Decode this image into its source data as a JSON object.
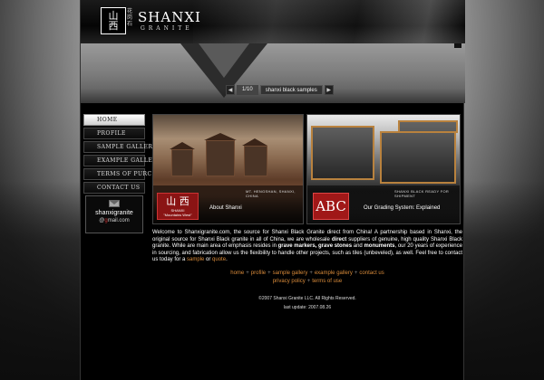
{
  "header": {
    "logo_chars": "山\n西",
    "logo_small_chars": "花岗石",
    "brand": "SHANXI",
    "brand_sub": "GRANITE"
  },
  "slideshow": {
    "counter": "1/10",
    "label": "shanxi black samples",
    "prev_icon": "prev-arrow-icon",
    "next_icon": "next-arrow-icon"
  },
  "nav": {
    "items": [
      {
        "label": "HOME",
        "active": true
      },
      {
        "label": "PROFILE",
        "active": false
      },
      {
        "label": "SAMPLE GALLERY",
        "active": false
      },
      {
        "label": "EXAMPLE GALLERY",
        "active": false
      },
      {
        "label": "TERMS OF PURCHASE",
        "active": false
      },
      {
        "label": "CONTACT US",
        "active": false
      }
    ]
  },
  "email": {
    "icon": "mail-icon",
    "user": "shanxigranite",
    "domain_prefix": "@",
    "domain_g": "g",
    "domain_rest": "mail.com"
  },
  "features": {
    "left": {
      "caption": "MT. HENGSHAN, SHANXI, CHINA",
      "thumb_chars": "山 西",
      "thumb_sub1": "SHANXI",
      "thumb_sub2": "\"Mountains West\"",
      "link": "About Shanxi"
    },
    "right": {
      "caption": "SHANXI BLACK READY FOR SHIPMENT",
      "thumb_text": "ABC",
      "link": "Our Grading System: Explained"
    }
  },
  "intro": {
    "p1": "Welcome to Shanxigranite.com, the source for Shanxi Black Granite direct from China! A partnership based in Shanxi, the original source for Shanxi Black granite in all of China, we are wholesale ",
    "b1": "direct",
    "p2": " suppliers of genuine, high quality Shanxi Black granite. While are main area of emphasis resides in ",
    "b2": "grave markers, grave stones",
    "p3": " and ",
    "b3": "monuments",
    "p4": ", our 20 years of experience in sourcing, and fabrication allow us the flexibility to handle other projects, such as tiles (unbeveled), as well. Feel free to contact us today for a ",
    "l1": "sample",
    "p5": " or ",
    "l2": "quote",
    "p6": "."
  },
  "footer": {
    "links_row1": [
      "home",
      "profile",
      "sample gallery",
      "example gallery",
      "contact us"
    ],
    "links_row2": [
      "privacy policy",
      "terms of use"
    ],
    "separator": "+",
    "copyright": "©2007 Shanxi Granite LLC. All Rights Reserved.",
    "last_update": "last update: 2007.08.26"
  },
  "colors": {
    "accent_link": "#d98b3a",
    "brand_red": "#8a1414",
    "background": "#000000"
  }
}
